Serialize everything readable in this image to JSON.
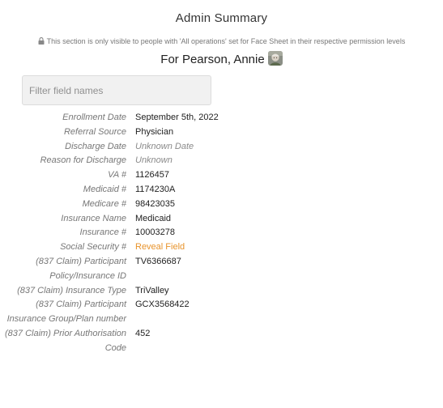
{
  "header": {
    "title": "Admin Summary",
    "notice": "This section is only visible to people with 'All operations' set for Face Sheet in their respective permission levels",
    "subject": "For Pearson, Annie"
  },
  "filter": {
    "placeholder": "Filter field names"
  },
  "fields": [
    {
      "label": "Enrollment Date",
      "value": "September 5th, 2022"
    },
    {
      "label": "Referral Source",
      "value": "Physician"
    },
    {
      "label": "Discharge Date",
      "value": "Unknown Date"
    },
    {
      "label": "Reason for Discharge",
      "value": "Unknown"
    },
    {
      "label": "VA #",
      "value": "1126457"
    },
    {
      "label": "Medicaid #",
      "value": "1174230A"
    },
    {
      "label": "Medicare #",
      "value": "98423035"
    },
    {
      "label": "Insurance Name",
      "value": "Medicaid"
    },
    {
      "label": "Insurance #",
      "value": "10003278"
    },
    {
      "label": "Social Security #",
      "value": "Reveal Field"
    },
    {
      "label": "(837 Claim) Participant Policy/Insurance ID",
      "value": "TV6366687"
    },
    {
      "label": "(837 Claim) Insurance Type",
      "value": "TriValley"
    },
    {
      "label": "(837 Claim) Participant Insurance Group/Plan number",
      "value": "GCX3568422"
    },
    {
      "label": "(837 Claim) Prior Authorisation Code",
      "value": "452"
    }
  ],
  "icons": {
    "lock": "lock-icon",
    "avatar": "avatar"
  },
  "colors": {
    "link": "#e8932b",
    "label": "#777777",
    "muted_value": "#8a8a8a"
  }
}
